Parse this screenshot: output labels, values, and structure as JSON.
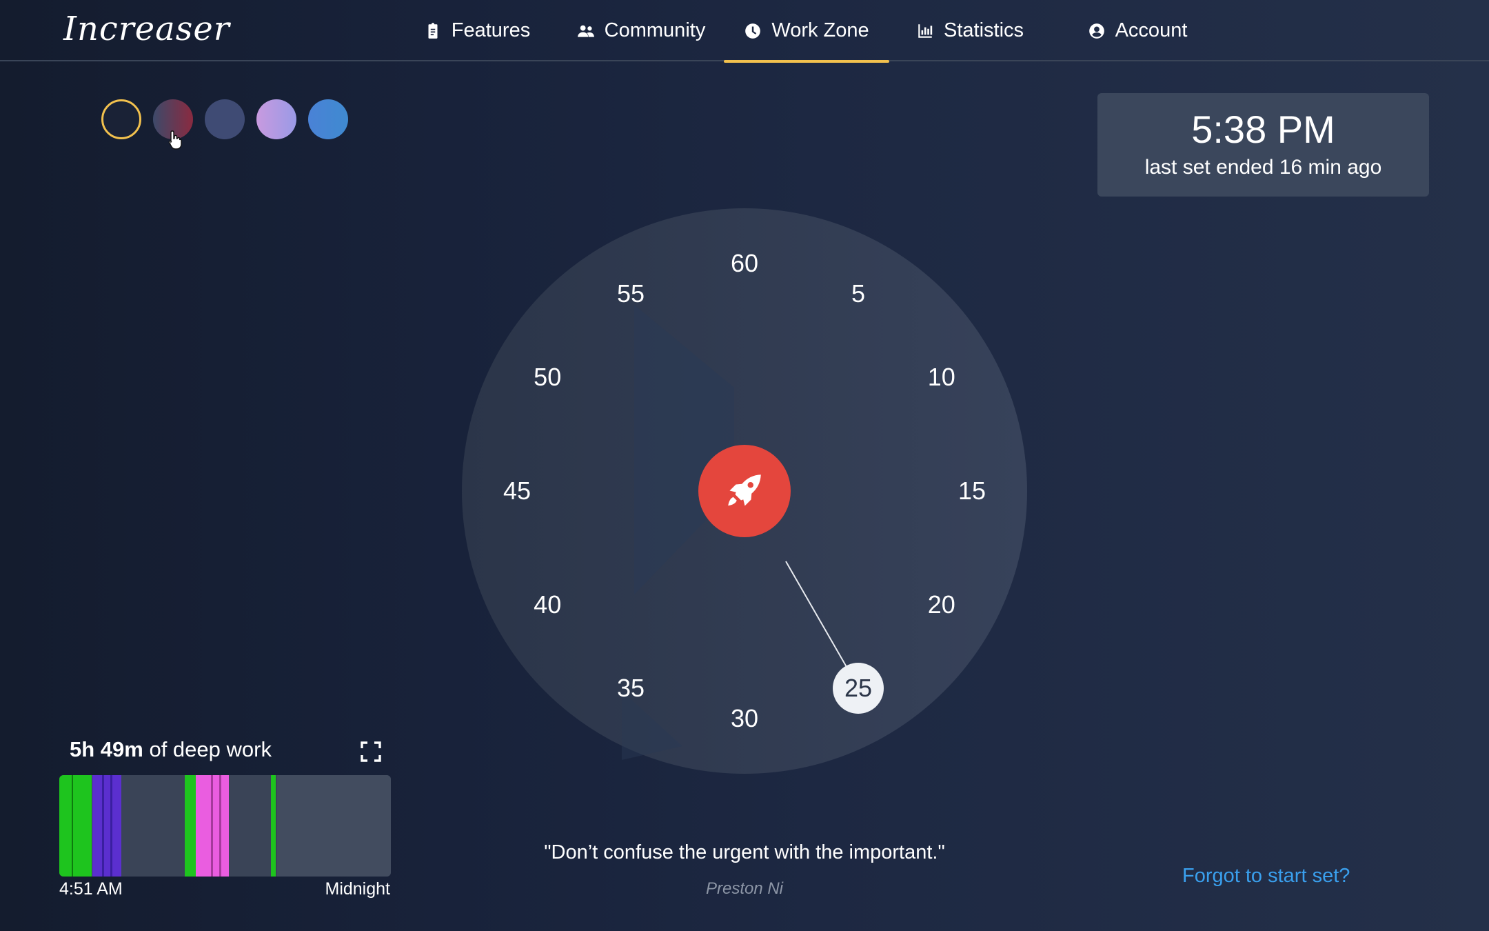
{
  "brand": {
    "logo_text": "Increaser"
  },
  "nav": {
    "items": [
      {
        "label": "Features",
        "icon": "clipboard-icon"
      },
      {
        "label": "Community",
        "icon": "users-icon"
      },
      {
        "label": "Work Zone",
        "icon": "clock-icon",
        "active": true
      },
      {
        "label": "Statistics",
        "icon": "bar-chart-icon"
      },
      {
        "label": "Account",
        "icon": "user-circle-icon"
      }
    ]
  },
  "themes": {
    "swatches": [
      {
        "name": "midnight",
        "color": "#1a2236",
        "selected": true
      },
      {
        "name": "crimson",
        "color": "#7a3a50"
      },
      {
        "name": "indigo",
        "color": "#3f4b74"
      },
      {
        "name": "lavender",
        "color": "#b49ae0"
      },
      {
        "name": "sky",
        "color": "#3f80d0"
      }
    ],
    "selected_ring_color": "#f2c14e"
  },
  "status": {
    "time": "5:38 PM",
    "last_set": "last set ended 16 min ago"
  },
  "timer": {
    "dial_numbers": [
      "60",
      "5",
      "10",
      "15",
      "20",
      "25",
      "30",
      "35",
      "40",
      "45",
      "50",
      "55"
    ],
    "selected_minutes": "25",
    "start_icon": "rocket-icon",
    "start_color": "#e4463d"
  },
  "deep_work": {
    "total": "5h 49m",
    "suffix": " of deep work",
    "start_label": "4:51 AM",
    "end_label": "Midnight",
    "colors": {
      "green": "#1ec41e",
      "purple": "#5b2fcf",
      "pink": "#ea5de0"
    }
  },
  "quote": {
    "text": "\"Don’t confuse the urgent with the important.\"",
    "author": "Preston Ni"
  },
  "links": {
    "forgot": "Forgot to start set?"
  }
}
